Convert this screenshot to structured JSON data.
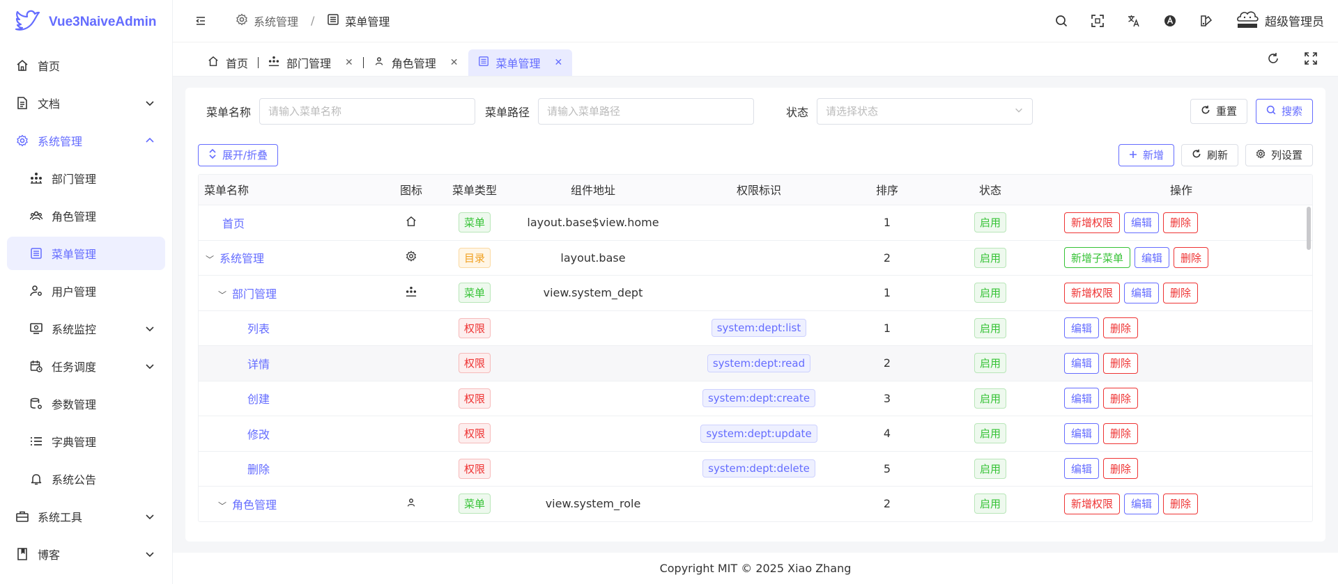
{
  "logo": {
    "text": "Vue3NaiveAdmin"
  },
  "sidebar": {
    "items": [
      {
        "label": "首页",
        "icon": "home-icon"
      },
      {
        "label": "文档",
        "icon": "document-icon"
      },
      {
        "label": "系统管理",
        "icon": "gear-icon"
      },
      {
        "label": "部门管理",
        "icon": "org-icon"
      },
      {
        "label": "角色管理",
        "icon": "users-icon"
      },
      {
        "label": "菜单管理",
        "icon": "menu-list-icon"
      },
      {
        "label": "用户管理",
        "icon": "user-gear-icon"
      },
      {
        "label": "系统监控",
        "icon": "monitor-icon"
      },
      {
        "label": "任务调度",
        "icon": "calendar-clock-icon"
      },
      {
        "label": "参数管理",
        "icon": "database-gear-icon"
      },
      {
        "label": "字典管理",
        "icon": "list-icon"
      },
      {
        "label": "系统公告",
        "icon": "bell-icon"
      },
      {
        "label": "系统工具",
        "icon": "toolbox-icon"
      },
      {
        "label": "博客",
        "icon": "blog-icon"
      }
    ]
  },
  "header": {
    "breadcrumb": [
      "系统管理",
      "菜单管理"
    ],
    "separator": "/",
    "user": "超级管理员"
  },
  "tabs": [
    {
      "label": "首页"
    },
    {
      "label": "部门管理"
    },
    {
      "label": "角色管理"
    },
    {
      "label": "菜单管理"
    }
  ],
  "search": {
    "name_label": "菜单名称",
    "name_placeholder": "请输入菜单名称",
    "path_label": "菜单路径",
    "path_placeholder": "请输入菜单路径",
    "status_label": "状态",
    "status_placeholder": "请选择状态",
    "reset": "重置",
    "search": "搜索"
  },
  "toolbar": {
    "expand": "展开/折叠",
    "add": "新增",
    "refresh": "刷新",
    "columns": "列设置"
  },
  "table": {
    "headers": [
      "菜单名称",
      "图标",
      "菜单类型",
      "组件地址",
      "权限标识",
      "排序",
      "状态",
      "操作"
    ],
    "rows": [
      {
        "name": "首页",
        "type": "菜单",
        "component": "layout.base$view.home",
        "perm": "",
        "sort": "1",
        "status": "启用",
        "ops": [
          "新增权限",
          "编辑",
          "删除"
        ]
      },
      {
        "name": "系统管理",
        "type": "目录",
        "component": "layout.base",
        "perm": "",
        "sort": "2",
        "status": "启用",
        "ops": [
          "新增子菜单",
          "编辑",
          "删除"
        ]
      },
      {
        "name": "部门管理",
        "type": "菜单",
        "component": "view.system_dept",
        "perm": "",
        "sort": "1",
        "status": "启用",
        "ops": [
          "新增权限",
          "编辑",
          "删除"
        ]
      },
      {
        "name": "列表",
        "type": "权限",
        "component": "",
        "perm": "system:dept:list",
        "sort": "1",
        "status": "启用",
        "ops": [
          "编辑",
          "删除"
        ]
      },
      {
        "name": "详情",
        "type": "权限",
        "component": "",
        "perm": "system:dept:read",
        "sort": "2",
        "status": "启用",
        "ops": [
          "编辑",
          "删除"
        ]
      },
      {
        "name": "创建",
        "type": "权限",
        "component": "",
        "perm": "system:dept:create",
        "sort": "3",
        "status": "启用",
        "ops": [
          "编辑",
          "删除"
        ]
      },
      {
        "name": "修改",
        "type": "权限",
        "component": "",
        "perm": "system:dept:update",
        "sort": "4",
        "status": "启用",
        "ops": [
          "编辑",
          "删除"
        ]
      },
      {
        "name": "删除",
        "type": "权限",
        "component": "",
        "perm": "system:dept:delete",
        "sort": "5",
        "status": "启用",
        "ops": [
          "编辑",
          "删除"
        ]
      },
      {
        "name": "角色管理",
        "type": "菜单",
        "component": "view.system_role",
        "perm": "",
        "sort": "2",
        "status": "启用",
        "ops": [
          "新增权限",
          "编辑",
          "删除"
        ]
      }
    ]
  },
  "footer": {
    "text": "Copyright MIT © 2025 Xiao Zhang"
  },
  "colors": {
    "accent": "#646cff",
    "success": "#34c234",
    "danger": "#ee3333",
    "warning": "#f0a020"
  }
}
